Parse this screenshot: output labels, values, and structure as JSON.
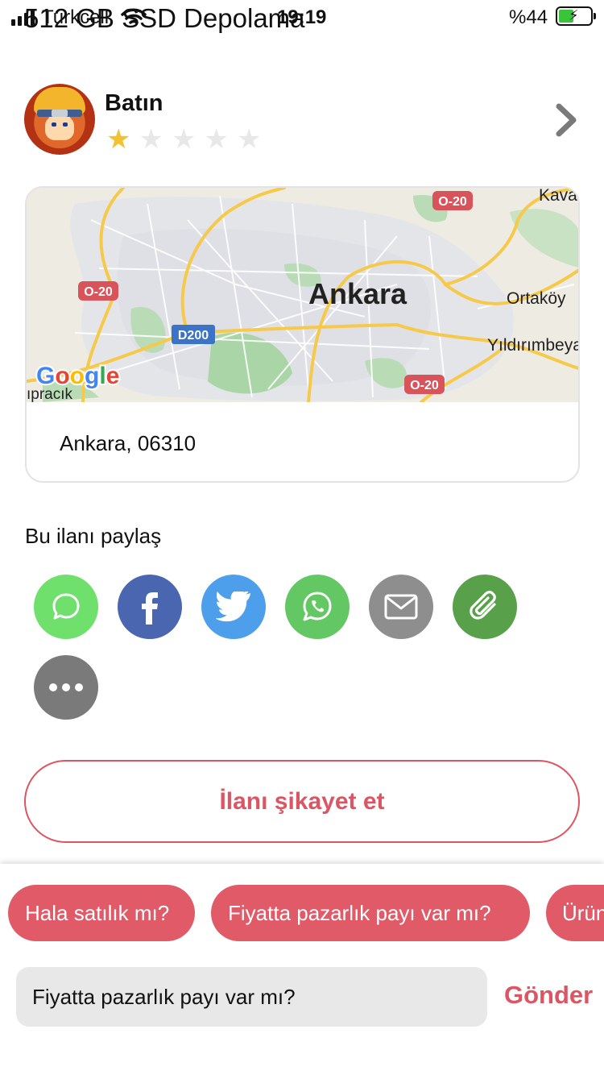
{
  "status_bar": {
    "carrier": "Turkcell",
    "time": "19:19",
    "battery": "%44"
  },
  "overlapping_title": "512 GB SSD Depolama",
  "seller": {
    "name": "Batın",
    "rating": 1,
    "max_rating": 5
  },
  "map": {
    "city_label": "Ankara",
    "labels": [
      "Ortaköy",
      "Yıldırımbeya",
      "Kava",
      "ıpracık"
    ],
    "road_shields": [
      "O-20",
      "O-20",
      "O-20",
      "D200"
    ],
    "provider": "Google"
  },
  "address": "Ankara, 06310",
  "share": {
    "title": "Bu ilanı paylaş",
    "buttons": [
      {
        "name": "sms",
        "icon": "chat-bubble-icon",
        "color": "#6fe06b"
      },
      {
        "name": "facebook",
        "icon": "facebook-icon",
        "color": "#4a66b0"
      },
      {
        "name": "twitter",
        "icon": "twitter-icon",
        "color": "#4d9fec"
      },
      {
        "name": "whatsapp",
        "icon": "whatsapp-icon",
        "color": "#63c863"
      },
      {
        "name": "email",
        "icon": "mail-icon",
        "color": "#8e8e8e"
      },
      {
        "name": "copy-link",
        "icon": "paperclip-icon",
        "color": "#58a04a"
      },
      {
        "name": "more",
        "icon": "ellipsis-icon",
        "color": "#7a7a7a"
      }
    ]
  },
  "report_button": "İlanı şikayet et",
  "quick_replies": [
    "Hala satılık mı?",
    "Fiyatta pazarlık payı var mı?",
    "Ürün"
  ],
  "message": {
    "value": "Fiyatta pazarlık payı var mı?",
    "send_label": "Gönder"
  },
  "colors": {
    "accent": "#dc5563",
    "chip": "#e05a68",
    "star_on": "#f1c232",
    "star_off": "#e8e8e8"
  }
}
